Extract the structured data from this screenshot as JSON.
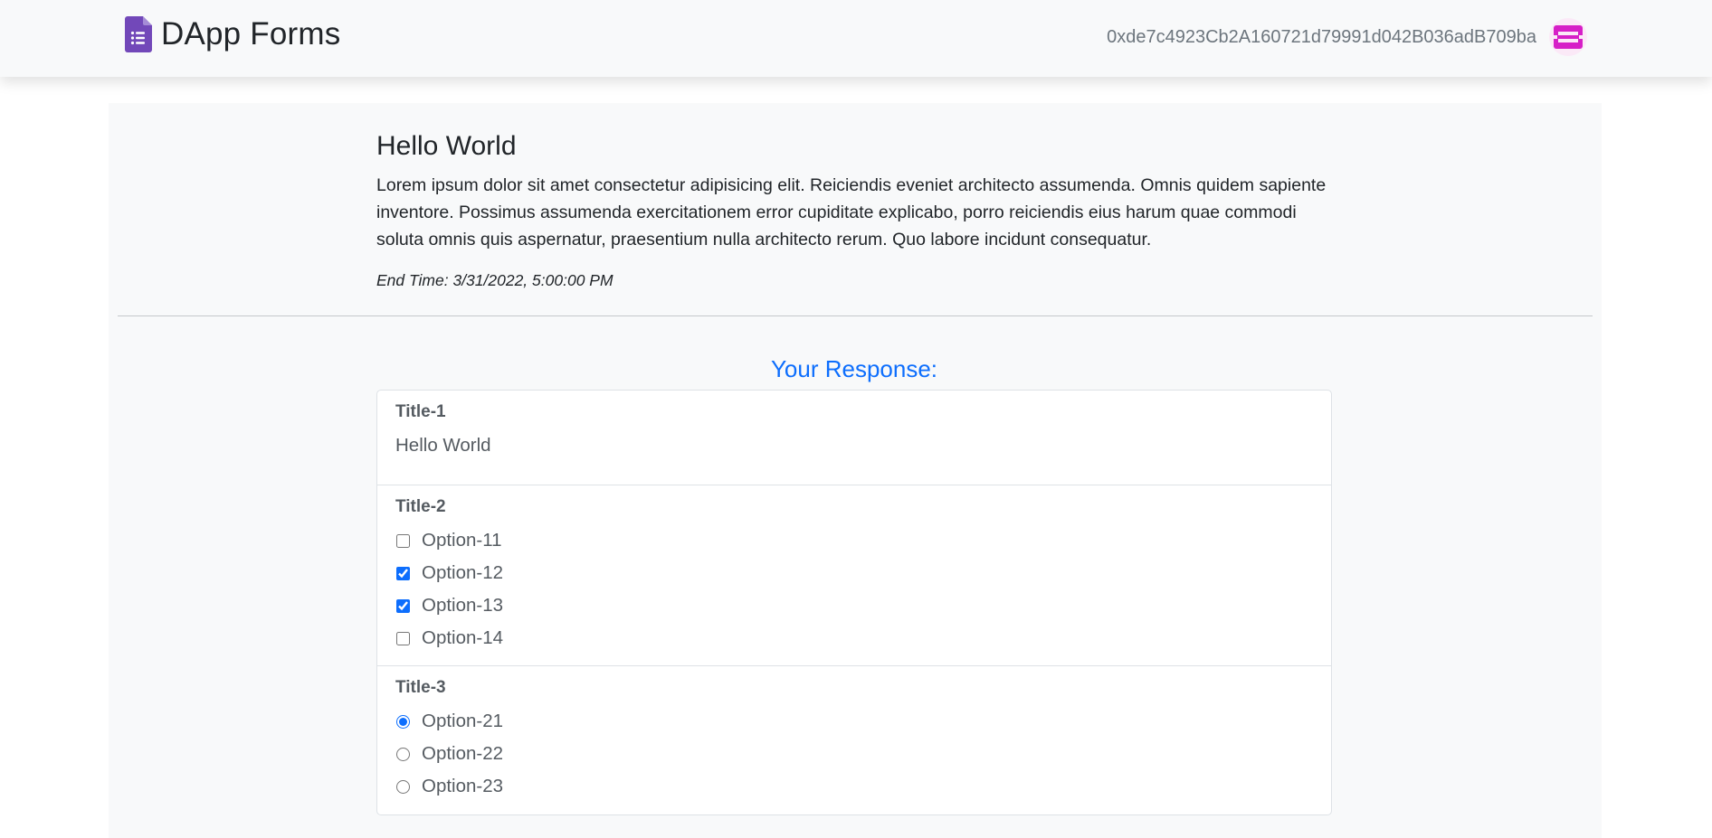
{
  "header": {
    "brand": "DApp Forms",
    "brand_icon": "google-forms-icon",
    "brand_color": "#7248b9",
    "account_address": "0xde7c4923Cb2A160721d79991d042B036adB709ba",
    "avatar_icon": "identicon-avatar",
    "avatar_color": "#d61fc7"
  },
  "form": {
    "title": "Hello World",
    "description": "Lorem ipsum dolor sit amet consectetur adipisicing elit. Reiciendis eveniet architecto assumenda. Omnis quidem sapiente inventore. Possimus assumenda exercitationem error cupiditate explicabo, porro reiciendis eius harum quae commodi soluta omnis quis aspernatur, praesentium nulla architecto rerum. Quo labore incidunt consequatur.",
    "end_time": "End Time: 3/31/2022, 5:00:00 PM"
  },
  "response": {
    "heading": "Your Response:",
    "accent_color": "#0d6efd",
    "questions": [
      {
        "title": "Title-1",
        "type": "text",
        "answer": "Hello World"
      },
      {
        "title": "Title-2",
        "type": "checkbox",
        "options": [
          {
            "label": "Option-11",
            "checked": false
          },
          {
            "label": "Option-12",
            "checked": true
          },
          {
            "label": "Option-13",
            "checked": true
          },
          {
            "label": "Option-14",
            "checked": false
          }
        ]
      },
      {
        "title": "Title-3",
        "type": "radio",
        "options": [
          {
            "label": "Option-21",
            "checked": true
          },
          {
            "label": "Option-22",
            "checked": false
          },
          {
            "label": "Option-23",
            "checked": false
          }
        ]
      }
    ]
  }
}
